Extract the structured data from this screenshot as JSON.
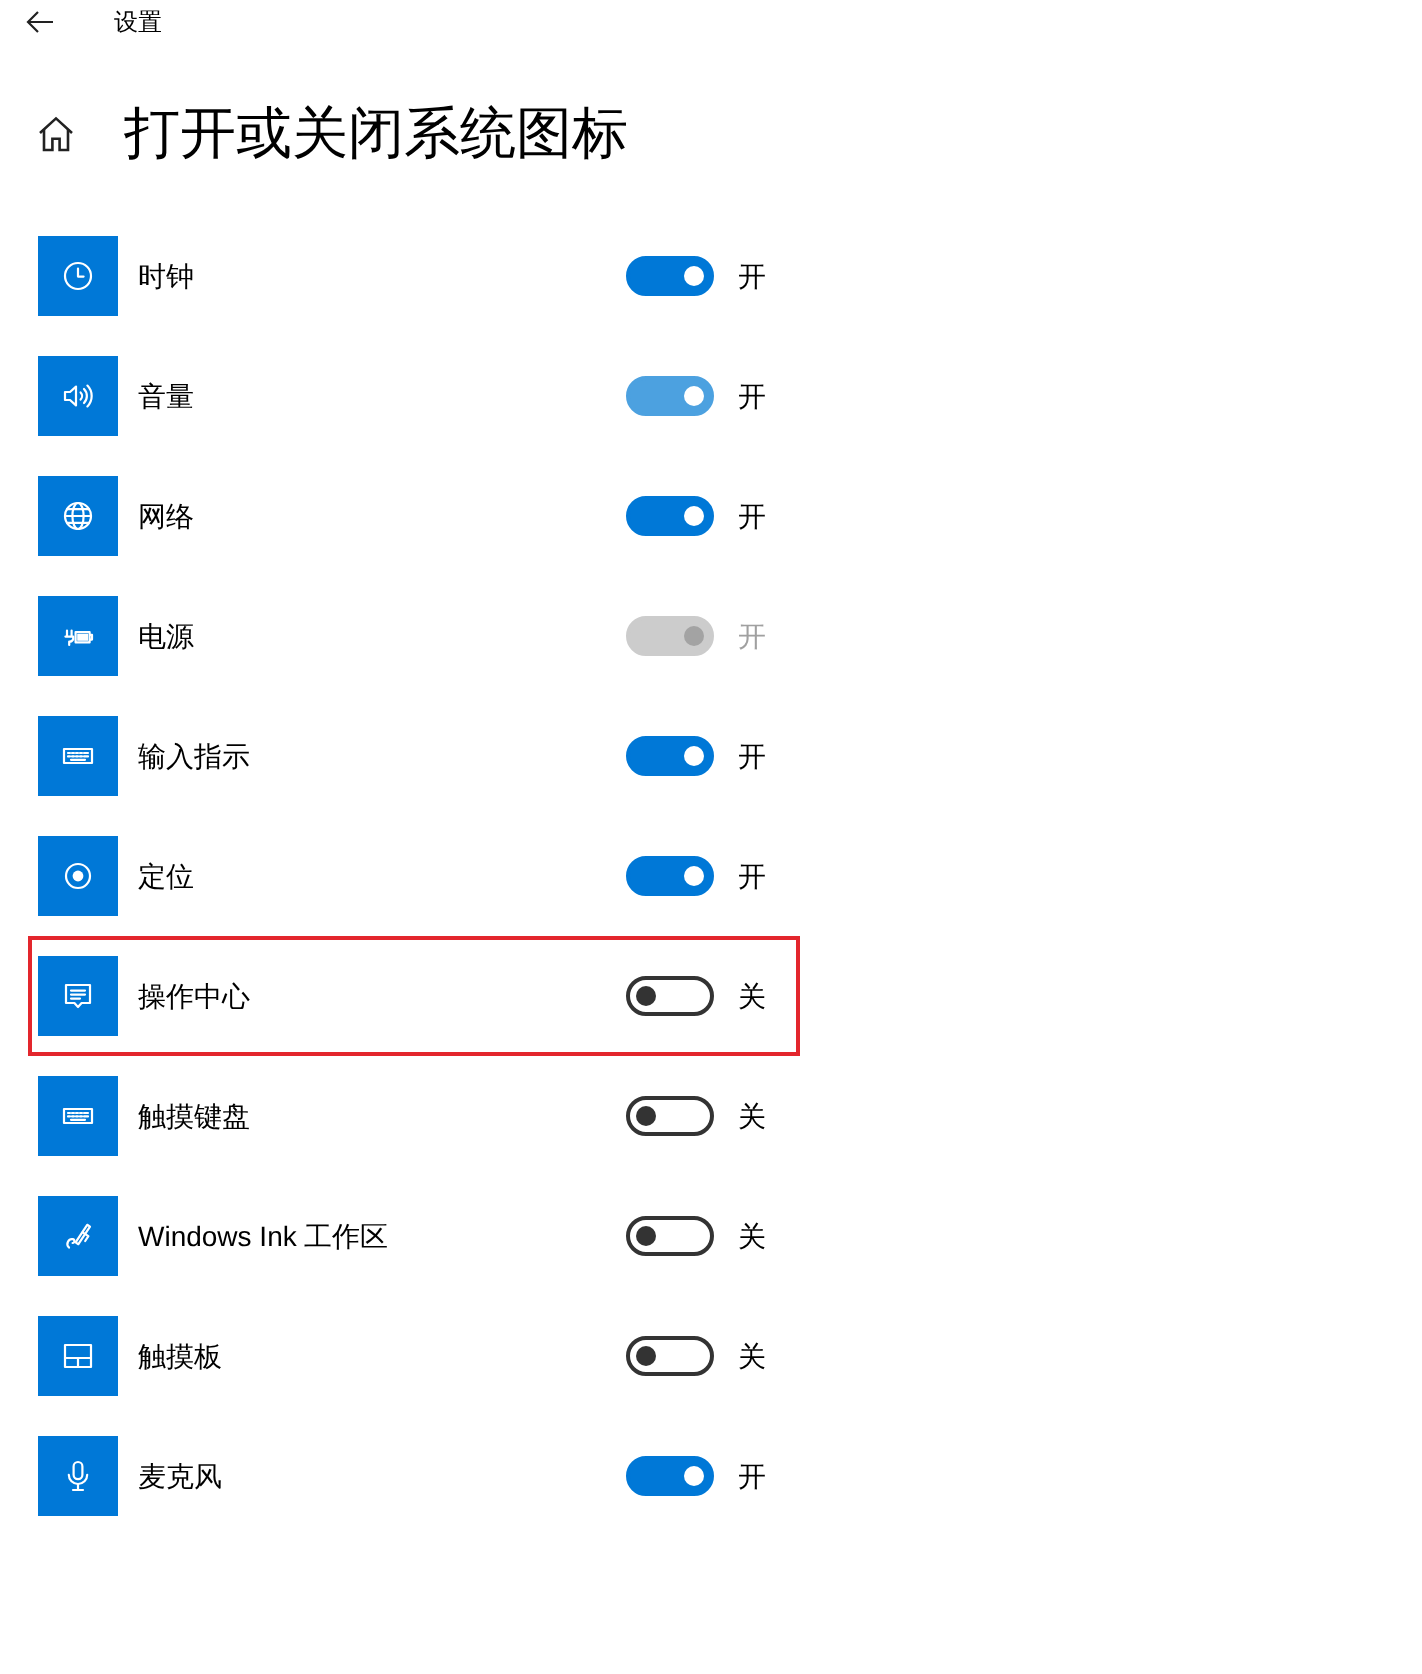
{
  "window": {
    "title": "设置"
  },
  "page": {
    "title": "打开或关闭系统图标"
  },
  "items": [
    {
      "label": "时钟",
      "on": true,
      "hovered": false,
      "disabled": false,
      "highlighted": false,
      "state_label": "开"
    },
    {
      "label": "音量",
      "on": true,
      "hovered": true,
      "disabled": false,
      "highlighted": false,
      "state_label": "开"
    },
    {
      "label": "网络",
      "on": true,
      "hovered": false,
      "disabled": false,
      "highlighted": false,
      "state_label": "开"
    },
    {
      "label": "电源",
      "on": true,
      "hovered": false,
      "disabled": true,
      "highlighted": false,
      "state_label": "开"
    },
    {
      "label": "输入指示",
      "on": true,
      "hovered": false,
      "disabled": false,
      "highlighted": false,
      "state_label": "开"
    },
    {
      "label": "定位",
      "on": true,
      "hovered": false,
      "disabled": false,
      "highlighted": false,
      "state_label": "开"
    },
    {
      "label": "操作中心",
      "on": false,
      "hovered": false,
      "disabled": false,
      "highlighted": true,
      "state_label": "关"
    },
    {
      "label": "触摸键盘",
      "on": false,
      "hovered": false,
      "disabled": false,
      "highlighted": false,
      "state_label": "关"
    },
    {
      "label": "Windows Ink 工作区",
      "on": false,
      "hovered": false,
      "disabled": false,
      "highlighted": false,
      "state_label": "关"
    },
    {
      "label": "触摸板",
      "on": false,
      "hovered": false,
      "disabled": false,
      "highlighted": false,
      "state_label": "关"
    },
    {
      "label": "麦克风",
      "on": true,
      "hovered": false,
      "disabled": false,
      "highlighted": false,
      "state_label": "开"
    }
  ]
}
